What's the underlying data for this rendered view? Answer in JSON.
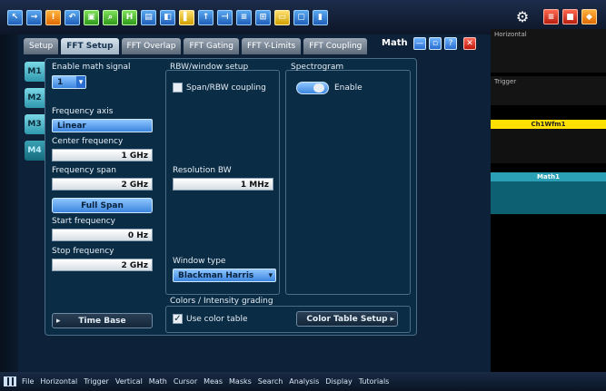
{
  "tabs": [
    "Setup",
    "FFT Setup",
    "FFT Overlap",
    "FFT Gating",
    "FFT Y-Limits",
    "FFT Coupling"
  ],
  "dialog": {
    "title": "Math"
  },
  "math_tabs": [
    "M1",
    "M2",
    "M3",
    "M4"
  ],
  "enable_math": {
    "label": "Enable math signal",
    "value": "1"
  },
  "frequency_axis": {
    "label": "Frequency axis",
    "value": "Linear"
  },
  "center_frequency": {
    "label": "Center frequency",
    "value": "1 GHz"
  },
  "frequency_span": {
    "label": "Frequency span",
    "value": "2 GHz"
  },
  "full_span_label": "Full Span",
  "start_frequency": {
    "label": "Start frequency",
    "value": "0 Hz"
  },
  "stop_frequency": {
    "label": "Stop frequency",
    "value": "2 GHz"
  },
  "time_base_label": "Time Base",
  "rbw": {
    "group_label": "RBW/window setup",
    "coupling_label": "Span/RBW coupling",
    "resolution_label": "Resolution BW",
    "resolution_value": "1 MHz",
    "window_type_label": "Window type",
    "window_type_value": "Blackman Harris"
  },
  "spectrogram": {
    "group_label": "Spectrogram",
    "enable_label": "Enable"
  },
  "colors": {
    "group_label": "Colors / Intensity grading",
    "use_color_table_label": "Use color table",
    "color_table_setup_label": "Color Table Setup"
  },
  "menubar": [
    "File",
    "Horizontal",
    "Trigger",
    "Vertical",
    "Math",
    "Cursor",
    "Meas",
    "Masks",
    "Search",
    "Analysis",
    "Display",
    "Tutorials"
  ],
  "right_panel": {
    "horizontal_title": "Horizontal",
    "trigger_title": "Trigger",
    "ch1_title": "Ch1Wfm1",
    "math_title": "Math1"
  }
}
